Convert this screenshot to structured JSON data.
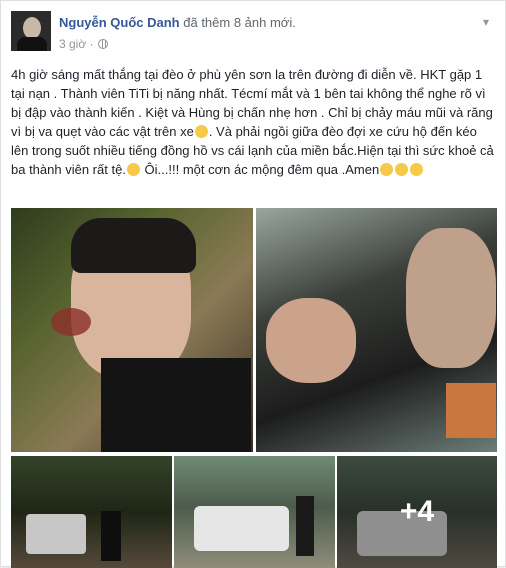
{
  "post": {
    "author": "Nguyễn Quốc Danh",
    "action": "đã thêm 8 ảnh mới.",
    "time": "3 giờ ·",
    "privacy_icon": "globe-icon",
    "menu_icon": "chevron-down-icon"
  },
  "body": {
    "paragraph": "4h giờ sáng mất thắng tại đèo ở phù yên sơn la trên đường đi diễn về. HKT gặp 1 tại nạn . Thành viên TiTi bị năng nhất. Técmí mắt và 1 bên tai không thể nghe rõ vì bị đập vào thành kiến . Kiệt và Hùng bị chấn nhẹ hơn . Chỉ bị chảy máu mũi và răng vì bị va quẹt vào các vật trên xe",
    "paragraph2": ". Và phải ngồi giữa đèo đợi xe cứu hộ đến kéo lên trong suốt nhiều tiếng đồng hồ vs cái lạnh của miền bắc.Hiện tại thì sức khoẻ cả ba thành viên rất tệ.",
    "paragraph3": " Ôi...!!! một cơn ác mộng đêm qua .Amen"
  },
  "photos": {
    "more_label": "+4"
  }
}
